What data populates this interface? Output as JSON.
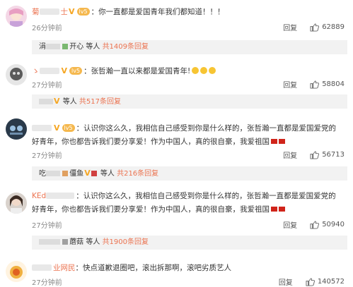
{
  "comments": [
    {
      "name": "菊",
      "name_suffix": "士",
      "level": "lv5",
      "separator": "：",
      "text": "你一直都是爱国青年我们都知道！！！",
      "time": "26分钟前",
      "reply": "回复",
      "likes": "62889",
      "sub": {
        "prefix": "涓",
        "name": "开心",
        "middle": "等人",
        "count": "共1409条回复"
      }
    },
    {
      "name": "ゝ",
      "level": "lv5",
      "separator": "：",
      "text": "张哲瀚一直以来都是爱国青年!",
      "time": "27分钟前",
      "reply": "回复",
      "likes": "58804",
      "sub": {
        "prefix": "",
        "name": "",
        "middle": "等人",
        "count": "共517条回复"
      }
    },
    {
      "name": "",
      "level": "lv5",
      "separator": "：",
      "text": "认识你这么久，我相信自己感受到你是什么样的，张哲瀚一直都是爱国爱党的好青年，你也都告诉我们要分享爱！作为中国人，真的很自豪，我爱祖国",
      "time": "27分钟前",
      "reply": "回复",
      "likes": "56713",
      "sub": {
        "prefix": "吃",
        "name": "僵鱼",
        "middle": "等人",
        "count": "共216条回复"
      }
    },
    {
      "name": "KEd",
      "level": "lv5",
      "separator": "：",
      "text": "认识你这么久，我相信自己感受到你是什么样的，张哲瀚一直都是爱国爱党的好青年，你也都告诉我们要分享爱！作为中国人，真的很自豪，我爱祖国",
      "time": "27分钟前",
      "reply": "回复",
      "likes": "50940",
      "sub": {
        "prefix": "",
        "name": "蘑菇",
        "middle": "等人",
        "count": "共1900条回复"
      }
    },
    {
      "name": "业网民",
      "level": "",
      "separator": "：",
      "text": "快点道歉退圈吧，滚出拆那啊，滚吧劣质艺人",
      "time": "27分钟前",
      "reply": "回复",
      "likes": "140572"
    }
  ],
  "colors": {
    "accent": "#eb7350",
    "badge": "#f5a623",
    "sub_bg": "#f2f2f2"
  },
  "icons": {
    "like": "thumbs-up-icon",
    "verified": "v-badge-icon"
  }
}
